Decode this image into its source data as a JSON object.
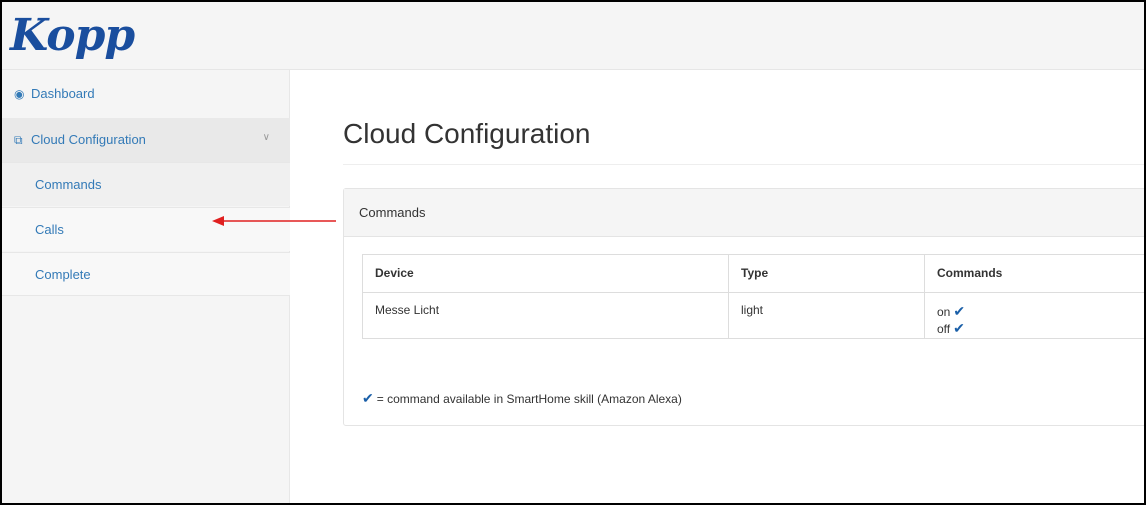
{
  "brand": {
    "logo_text": "Kopp",
    "logo_color": "#1a4e9e"
  },
  "sidebar": {
    "dashboard": {
      "label": "Dashboard",
      "icon": "tachometer-icon"
    },
    "cloud_configuration": {
      "label": "Cloud Configuration",
      "icon": "copy-icon",
      "expanded": true
    },
    "sub_items": [
      {
        "label": "Commands"
      },
      {
        "label": "Calls"
      },
      {
        "label": "Complete"
      }
    ]
  },
  "main": {
    "title": "Cloud Configuration",
    "panel": {
      "heading": "Commands",
      "table": {
        "headers": [
          "Device",
          "Type",
          "Commands"
        ],
        "rows": [
          {
            "device": "Messe Licht",
            "type": "light",
            "commands": [
              "on",
              "off"
            ]
          }
        ]
      },
      "legend": "= command available in SmartHome skill (Amazon Alexa)"
    }
  },
  "colors": {
    "link": "#337ab7",
    "check": "#1a5fa8",
    "annotation_arrow": "#e02020"
  }
}
